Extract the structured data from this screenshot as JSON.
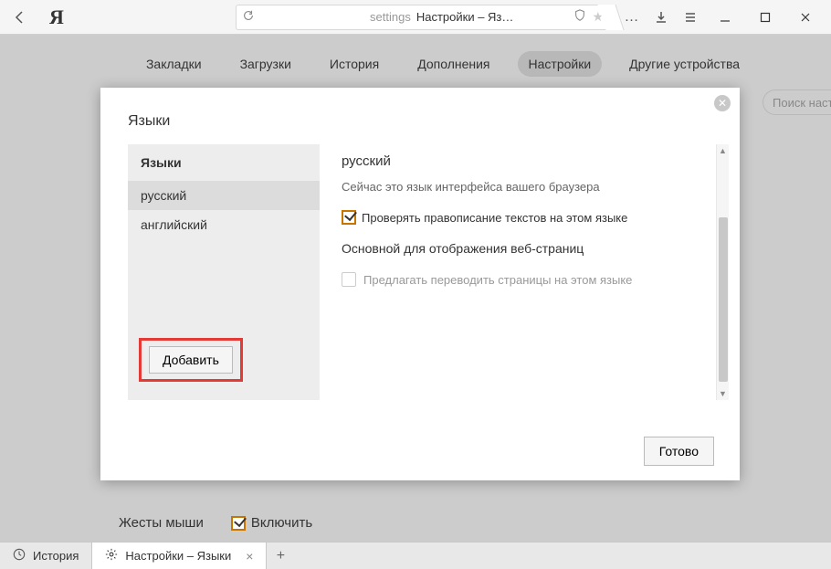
{
  "titlebar": {
    "address_prefix": "settings",
    "address_text": "Настройки – Яз…"
  },
  "nav": {
    "tabs": [
      {
        "label": "Закладки"
      },
      {
        "label": "Загрузки"
      },
      {
        "label": "История"
      },
      {
        "label": "Дополнения"
      },
      {
        "label": "Настройки"
      },
      {
        "label": "Другие устройства"
      }
    ],
    "search_placeholder": "Поиск настр"
  },
  "gestures": {
    "label": "Жесты мыши",
    "enable_label": "Включить"
  },
  "dialog": {
    "title": "Языки",
    "list_header": "Языки",
    "items": [
      {
        "label": "русский"
      },
      {
        "label": "английский"
      }
    ],
    "add_label": "Добавить",
    "detail": {
      "name": "русский",
      "interface_note": "Сейчас это язык интерфейса вашего браузера",
      "spellcheck_label": "Проверять правописание текстов на этом языке",
      "primary_label": "Основной для отображения веб-страниц",
      "translate_label": "Предлагать переводить страницы на этом языке"
    },
    "done_label": "Готово"
  },
  "bottom": {
    "tabs": [
      {
        "label": "История"
      },
      {
        "label": "Настройки – Языки"
      }
    ]
  }
}
